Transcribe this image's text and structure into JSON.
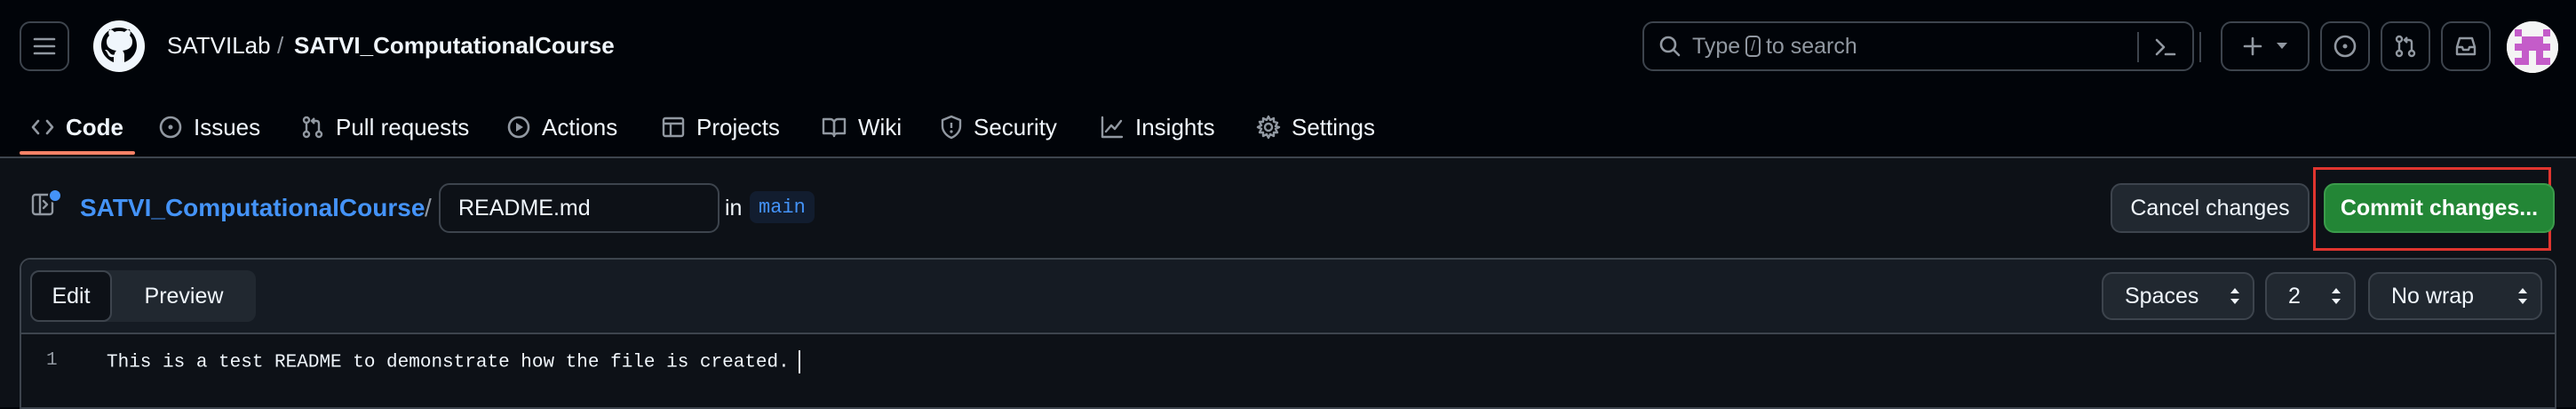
{
  "header": {
    "owner": "SATVILab",
    "separator": "/",
    "repo": "SATVI_ComputationalCourse",
    "search": {
      "prefix": "Type",
      "key": "/",
      "suffix": "to search"
    }
  },
  "repo_nav": {
    "items": [
      {
        "label": "Code",
        "icon": "code-icon",
        "active": true
      },
      {
        "label": "Issues",
        "icon": "issue-opened-icon"
      },
      {
        "label": "Pull requests",
        "icon": "git-pull-request-icon"
      },
      {
        "label": "Actions",
        "icon": "play-icon"
      },
      {
        "label": "Projects",
        "icon": "table-icon"
      },
      {
        "label": "Wiki",
        "icon": "book-icon"
      },
      {
        "label": "Security",
        "icon": "shield-icon"
      },
      {
        "label": "Insights",
        "icon": "graph-icon"
      },
      {
        "label": "Settings",
        "icon": "gear-icon"
      }
    ]
  },
  "editor": {
    "repo_link": "SATVI_ComputationalCourse",
    "path_separator": "/",
    "filename": "README.md",
    "in_label": "in",
    "branch": "main",
    "cancel_label": "Cancel changes",
    "commit_label": "Commit changes...",
    "tabs": {
      "edit": "Edit",
      "preview": "Preview"
    },
    "indent_mode": "Spaces",
    "indent_size": "2",
    "wrap_mode": "No wrap",
    "lines": [
      {
        "number": "1",
        "text": "This is a test README to demonstrate how the file is created."
      }
    ]
  },
  "colors": {
    "background": "#010409",
    "link": "#4493f8",
    "commit_green": "#238636",
    "highlight_red": "#e0352f",
    "active_underline": "#f78166"
  }
}
